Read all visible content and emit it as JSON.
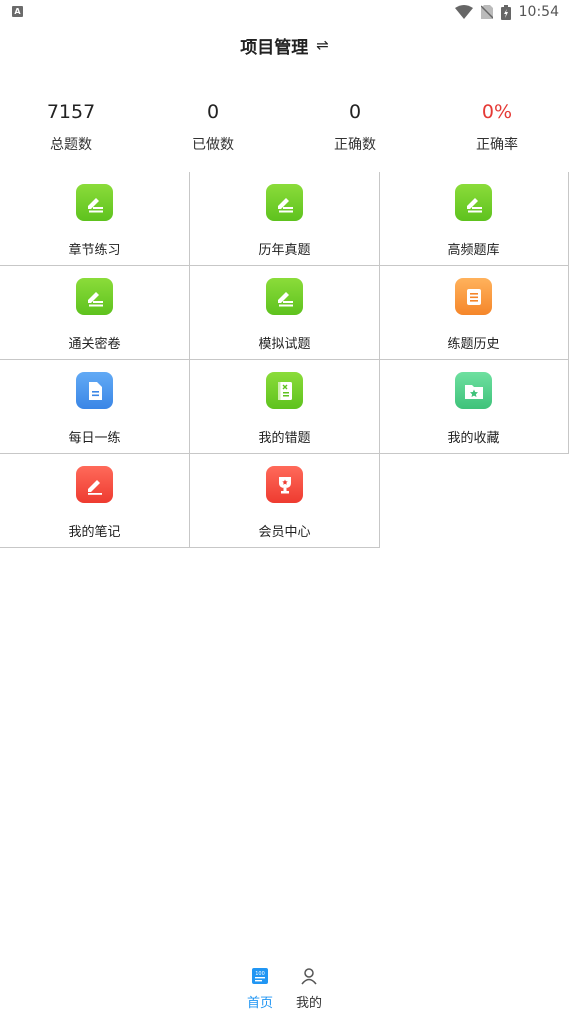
{
  "status_bar": {
    "time": "10:54"
  },
  "header": {
    "title": "项目管理",
    "switch_icon": "⇌"
  },
  "stats": [
    {
      "value": "7157",
      "label": "总题数"
    },
    {
      "value": "0",
      "label": "已做数"
    },
    {
      "value": "0",
      "label": "正确数"
    },
    {
      "value": "0%",
      "label": "正确率",
      "color": "#e53935"
    }
  ],
  "grid": [
    {
      "label": "章节练习",
      "icon": "pencil-list-icon",
      "color": "green"
    },
    {
      "label": "历年真题",
      "icon": "pencil-list-icon",
      "color": "green"
    },
    {
      "label": "高频题库",
      "icon": "pencil-list-icon",
      "color": "green"
    },
    {
      "label": "通关密卷",
      "icon": "pencil-list-icon",
      "color": "green"
    },
    {
      "label": "模拟试题",
      "icon": "pencil-list-icon",
      "color": "green"
    },
    {
      "label": "练题历史",
      "icon": "scroll-icon",
      "color": "orange"
    },
    {
      "label": "每日一练",
      "icon": "document-icon",
      "color": "blue"
    },
    {
      "label": "我的错题",
      "icon": "wrong-book-icon",
      "color": "green"
    },
    {
      "label": "我的收藏",
      "icon": "star-folder-icon",
      "color": "teal"
    },
    {
      "label": "我的笔记",
      "icon": "pencil-icon",
      "color": "red"
    },
    {
      "label": "会员中心",
      "icon": "trophy-icon",
      "color": "red"
    }
  ],
  "bottom_nav": [
    {
      "label": "首页",
      "icon": "home-icon",
      "active": true
    },
    {
      "label": "我的",
      "icon": "user-icon",
      "active": false
    }
  ],
  "colors": {
    "accent": "#2196f3",
    "rate": "#e53935"
  }
}
